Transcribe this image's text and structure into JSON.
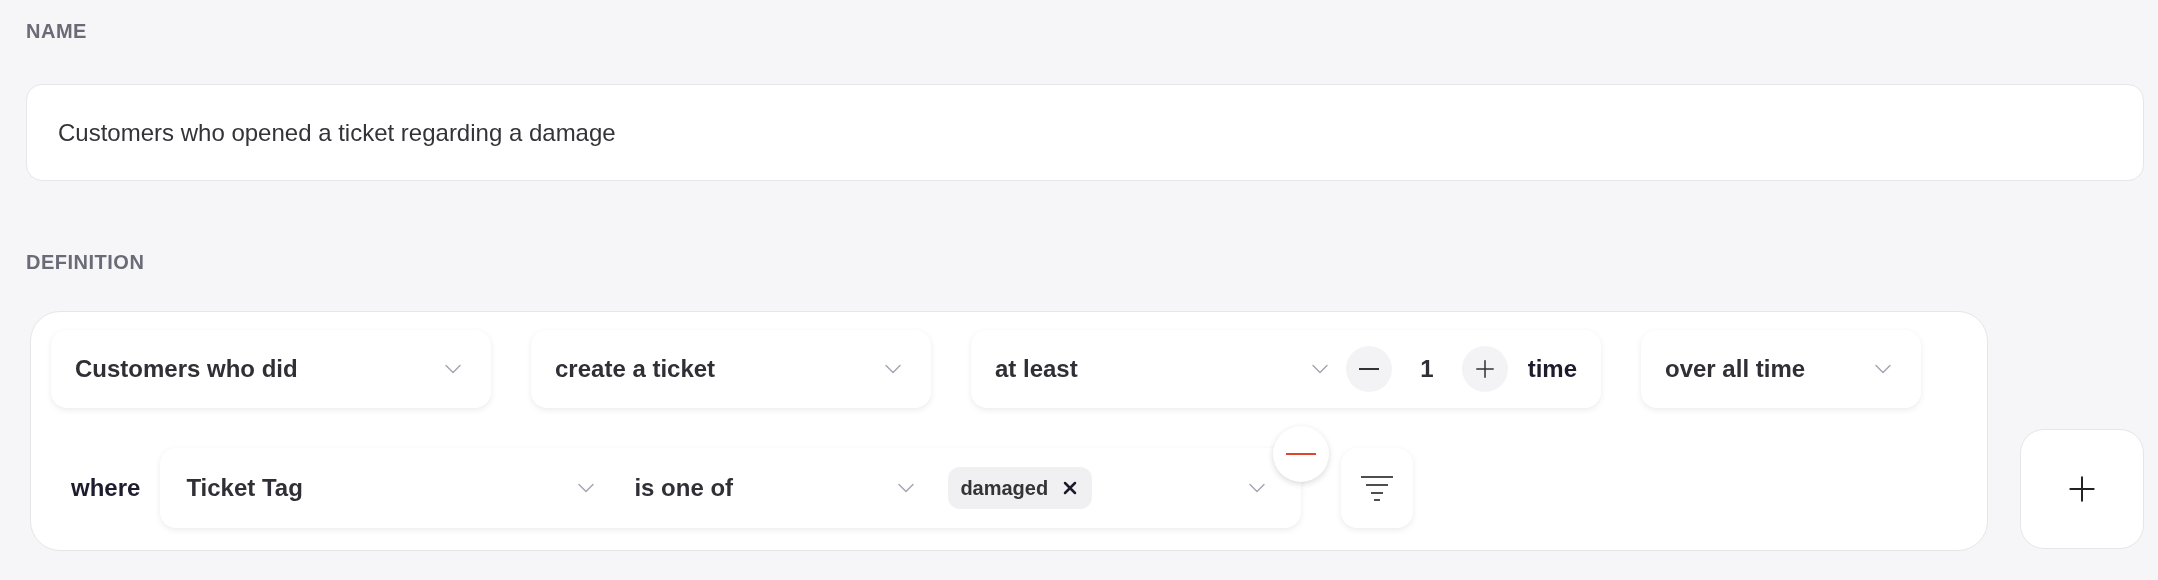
{
  "name_section": {
    "label": "NAME",
    "value": "Customers who opened a ticket regarding a damage"
  },
  "definition": {
    "label": "DEFINITION",
    "subject": {
      "value": "Customers who did"
    },
    "event": {
      "value": "create a ticket"
    },
    "frequency": {
      "operator": "at least",
      "count": "1",
      "unit": "time"
    },
    "timeframe": {
      "value": "over all time"
    },
    "filter": {
      "prefix": "where",
      "property": "Ticket Tag",
      "operator": "is one of",
      "tags": [
        {
          "label": "damaged"
        }
      ]
    }
  }
}
